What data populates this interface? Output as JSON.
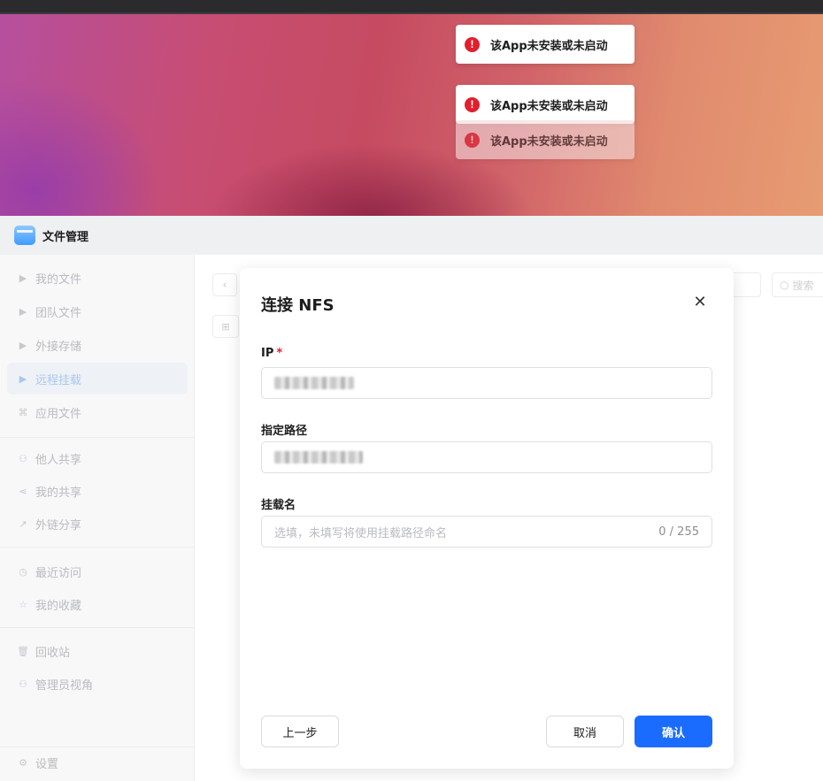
{
  "toasts": [
    {
      "message": "该App未安装或未启动"
    },
    {
      "message": "该App未安装或未启动"
    },
    {
      "message": "该App未安装或未启动"
    }
  ],
  "app": {
    "title": "文件管理"
  },
  "sidebar": {
    "items": [
      {
        "label": "我的文件",
        "icon": "caret-right-icon"
      },
      {
        "label": "团队文件",
        "icon": "caret-right-icon"
      },
      {
        "label": "外接存储",
        "icon": "caret-right-icon"
      },
      {
        "label": "远程挂载",
        "icon": "caret-right-icon",
        "active": true
      },
      {
        "label": "应用文件",
        "icon": "apps-icon"
      },
      {
        "label": "他人共享",
        "icon": "user-share-icon"
      },
      {
        "label": "我的共享",
        "icon": "share-icon"
      },
      {
        "label": "外链分享",
        "icon": "external-link-icon"
      },
      {
        "label": "最近访问",
        "icon": "clock-icon"
      },
      {
        "label": "我的收藏",
        "icon": "star-icon"
      },
      {
        "label": "回收站",
        "icon": "trash-icon"
      },
      {
        "label": "管理员视角",
        "icon": "admin-icon"
      },
      {
        "label": "设置",
        "icon": "gear-icon"
      }
    ]
  },
  "toolbar": {
    "search_placeholder": "搜索"
  },
  "modal": {
    "title": "连接 NFS",
    "fields": {
      "ip": {
        "label": "IP",
        "required_mark": "*"
      },
      "path": {
        "label": "指定路径"
      },
      "mount_name": {
        "label": "挂载名",
        "placeholder": "选填，未填写将使用挂载路径命名",
        "counter": "0 / 255"
      }
    },
    "buttons": {
      "prev": "上一步",
      "cancel": "取消",
      "confirm": "确认"
    }
  },
  "colors": {
    "primary": "#1a6cff",
    "error": "#e0202e",
    "required": "#e0202e"
  }
}
